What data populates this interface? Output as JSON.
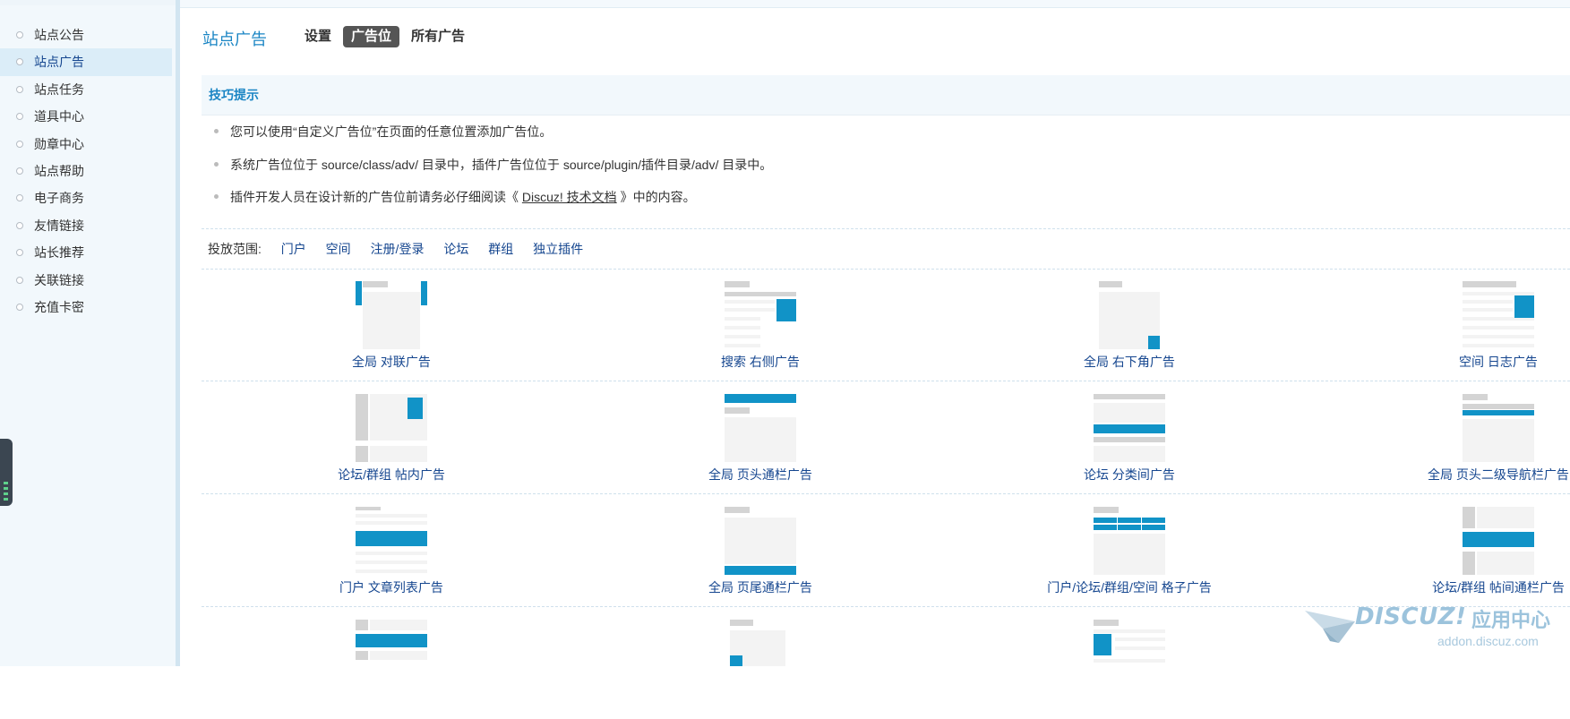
{
  "sidebar": {
    "items": [
      {
        "label": "站点公告",
        "active": false
      },
      {
        "label": "站点广告",
        "active": true
      },
      {
        "label": "站点任务",
        "active": false
      },
      {
        "label": "道具中心",
        "active": false
      },
      {
        "label": "勋章中心",
        "active": false
      },
      {
        "label": "站点帮助",
        "active": false
      },
      {
        "label": "电子商务",
        "active": false
      },
      {
        "label": "友情链接",
        "active": false
      },
      {
        "label": "站长推荐",
        "active": false
      },
      {
        "label": "关联链接",
        "active": false
      },
      {
        "label": "充值卡密",
        "active": false
      }
    ]
  },
  "header": {
    "title": "站点广告",
    "tabs": [
      {
        "label": "设置",
        "active": false
      },
      {
        "label": "广告位",
        "active": true
      },
      {
        "label": "所有广告",
        "active": false
      }
    ]
  },
  "tips": {
    "heading": "技巧提示",
    "items": [
      {
        "text": "您可以使用“自定义广告位”在页面的任意位置添加广告位。"
      },
      {
        "text": "系统广告位位于 source/class/adv/ 目录中，插件广告位位于 source/plugin/插件目录/adv/ 目录中。"
      },
      {
        "before": "插件开发人员在设计新的广告位前请务必仔细阅读《 ",
        "link": "Discuz! 技术文档",
        "after": " 》中的内容。"
      }
    ]
  },
  "filter": {
    "label": "投放范围:",
    "options": [
      "门户",
      "空间",
      "注册/登录",
      "论坛",
      "群组",
      "独立插件"
    ]
  },
  "ads": [
    {
      "label": "全局 对联广告",
      "icon": "couplet-ad-icon"
    },
    {
      "label": "搜索 右侧广告",
      "icon": "search-right-ad-icon"
    },
    {
      "label": "全局 右下角广告",
      "icon": "bottom-right-ad-icon"
    },
    {
      "label": "空间 日志广告",
      "icon": "blog-ad-icon"
    },
    {
      "label": "论坛/群组 帖内广告",
      "icon": "thread-inner-ad-icon"
    },
    {
      "label": "全局 页头通栏广告",
      "icon": "header-banner-ad-icon"
    },
    {
      "label": "论坛 分类间广告",
      "icon": "category-ad-icon"
    },
    {
      "label": "全局 页头二级导航栏广告",
      "icon": "subnav-ad-icon"
    },
    {
      "label": "门户 文章列表广告",
      "icon": "article-list-ad-icon"
    },
    {
      "label": "全局 页尾通栏广告",
      "icon": "footer-banner-ad-icon"
    },
    {
      "label": "门户/论坛/群组/空间 格子广告",
      "icon": "grid-ad-icon"
    },
    {
      "label": "论坛/群组 帖间通栏广告",
      "icon": "interthread-ad-icon"
    },
    {
      "label": "",
      "icon": "ad-thumb-icon"
    },
    {
      "label": "",
      "icon": "ad-thumb-icon"
    },
    {
      "label": "",
      "icon": "ad-thumb-icon"
    }
  ],
  "logo": {
    "brand": "DISCUZ!",
    "cn": "应用中心",
    "url": "addon.discuz.com"
  },
  "colors": {
    "accent": "#1193c7",
    "link": "#15468f",
    "title": "#1a85c4",
    "active_tab_bg": "#555555"
  }
}
